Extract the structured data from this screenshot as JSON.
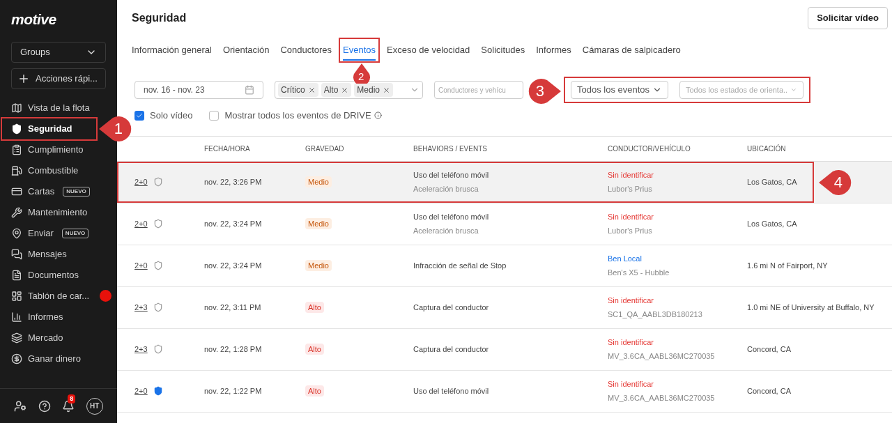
{
  "sidebar": {
    "logo": "motive",
    "groups": {
      "label": "Groups"
    },
    "quick_actions": {
      "label": "Acciones rápi..."
    },
    "items": [
      {
        "label": "Vista de la flota",
        "selected": false
      },
      {
        "label": "Seguridad",
        "selected": true,
        "callout": "1"
      },
      {
        "label": "Cumplimiento",
        "selected": false
      },
      {
        "label": "Combustible",
        "selected": false
      },
      {
        "label": "Cartas",
        "selected": false,
        "badge": "NUEVO"
      },
      {
        "label": "Mantenimiento",
        "selected": false
      },
      {
        "label": "Enviar",
        "selected": false,
        "badge": "NUEVO"
      },
      {
        "label": "Mensajes",
        "selected": false
      },
      {
        "label": "Documentos",
        "selected": false
      },
      {
        "label": "Tablón de car...",
        "selected": false,
        "alert": true
      },
      {
        "label": "Informes",
        "selected": false
      },
      {
        "label": "Mercado",
        "selected": false
      },
      {
        "label": "Ganar dinero",
        "selected": false
      }
    ],
    "footer": {
      "notifications": "8",
      "avatar": "HT"
    }
  },
  "header": {
    "title": "Seguridad",
    "button": "Solicitar vídeo"
  },
  "tabs": [
    {
      "label": "Información general",
      "selected": false
    },
    {
      "label": "Orientación",
      "selected": false
    },
    {
      "label": "Conductores",
      "selected": false
    },
    {
      "label": "Eventos",
      "selected": true,
      "callout": "2"
    },
    {
      "label": "Exceso de velocidad",
      "selected": false
    },
    {
      "label": "Solicitudes",
      "selected": false
    },
    {
      "label": "Informes",
      "selected": false
    },
    {
      "label": "Cámaras de salpicadero",
      "selected": false
    }
  ],
  "filters": {
    "date_range": "nov. 16 - nov. 23",
    "severity_chips": [
      "Crítico",
      "Alto",
      "Medio"
    ],
    "drivers": {
      "placeholder": "Conductores y vehícu"
    },
    "events": {
      "value": "Todos los eventos"
    },
    "coaching": {
      "placeholder": "Todos los estados de orienta.."
    },
    "callout": "3"
  },
  "options": [
    {
      "label": "Solo vídeo",
      "checked": true
    },
    {
      "label": "Mostrar todos los eventos de DRIVE",
      "checked": false,
      "info": true
    }
  ],
  "table": {
    "columns": [
      "FECHA/HORA",
      "GRAVEDAD",
      "BEHAVIORS / EVENTS",
      "CONDUCTOR/VEHÍCULO",
      "UBICACIÓN"
    ],
    "rows": [
      {
        "score": "2+0",
        "reviewed": false,
        "datetime": "nov. 22, 3:26 PM",
        "severity": {
          "label": "Medio",
          "kind": "medium"
        },
        "events": [
          "Uso del teléfono móvil",
          "Aceleración brusca"
        ],
        "driver": {
          "name": "Sin identificar",
          "identified": false
        },
        "vehicle": "Lubor's Prius",
        "location": "Los Gatos, CA",
        "selected": true,
        "callout": "4"
      },
      {
        "score": "2+0",
        "reviewed": false,
        "datetime": "nov. 22, 3:24 PM",
        "severity": {
          "label": "Medio",
          "kind": "medium"
        },
        "events": [
          "Uso del teléfono móvil",
          "Aceleración brusca"
        ],
        "driver": {
          "name": "Sin identificar",
          "identified": false
        },
        "vehicle": "Lubor's Prius",
        "location": "Los Gatos, CA",
        "selected": false
      },
      {
        "score": "2+0",
        "reviewed": false,
        "datetime": "nov. 22, 3:24 PM",
        "severity": {
          "label": "Medio",
          "kind": "medium"
        },
        "events": [
          "Infracción de señal de Stop"
        ],
        "driver": {
          "name": "Ben Local",
          "identified": true
        },
        "vehicle": "Ben's X5 - Hubble",
        "location": "1.6 mi N of Fairport, NY",
        "selected": false
      },
      {
        "score": "2+3",
        "reviewed": false,
        "datetime": "nov. 22, 3:11 PM",
        "severity": {
          "label": "Alto",
          "kind": "high"
        },
        "events": [
          "Captura del conductor"
        ],
        "driver": {
          "name": "Sin identificar",
          "identified": false
        },
        "vehicle": "SC1_QA_AABL3DB180213",
        "location": "1.0 mi NE of University at Buffalo, NY",
        "selected": false
      },
      {
        "score": "2+3",
        "reviewed": false,
        "datetime": "nov. 22, 1:28 PM",
        "severity": {
          "label": "Alto",
          "kind": "high"
        },
        "events": [
          "Captura del conductor"
        ],
        "driver": {
          "name": "Sin identificar",
          "identified": false
        },
        "vehicle": "MV_3.6CA_AABL36MC270035",
        "location": "Concord, CA",
        "selected": false
      },
      {
        "score": "2+0",
        "reviewed": true,
        "datetime": "nov. 22, 1:22 PM",
        "severity": {
          "label": "Alto",
          "kind": "high"
        },
        "events": [
          "Uso del teléfono móvil"
        ],
        "driver": {
          "name": "Sin identificar",
          "identified": false
        },
        "vehicle": "MV_3.6CA_AABL36MC270035",
        "location": "Concord, CA",
        "selected": false
      }
    ]
  }
}
